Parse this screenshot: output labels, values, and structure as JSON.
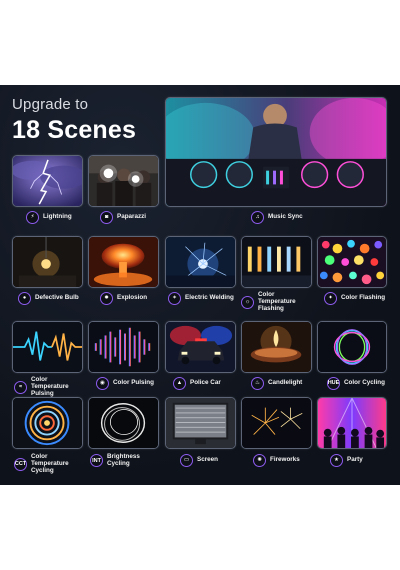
{
  "headline": {
    "upgrade": "Upgrade to",
    "title": "18 Scenes"
  },
  "scenes": [
    {
      "label": "Lightning",
      "icon": "lightning-icon"
    },
    {
      "label": "Paparazzi",
      "icon": "camera-icon"
    },
    {
      "label": "Music Sync",
      "icon": "music-note-icon"
    },
    {
      "label": "Defective Bulb",
      "icon": "bulb-icon"
    },
    {
      "label": "Explosion",
      "icon": "bomb-icon"
    },
    {
      "label": "Electric Welding",
      "icon": "spark-icon"
    },
    {
      "label": "Color Temperature Flashing",
      "icon": "color-temperature-icon"
    },
    {
      "label": "Color Flashing",
      "icon": "color-flash-icon"
    },
    {
      "label": "Color Temperature Pulsing",
      "icon": "wave-icon"
    },
    {
      "label": "Color Pulsing",
      "icon": "pulse-icon"
    },
    {
      "label": "Police Car",
      "icon": "police-light-icon"
    },
    {
      "label": "Candlelight",
      "icon": "flame-icon"
    },
    {
      "label": "Color Cycling",
      "icon_text": "HUE"
    },
    {
      "label": "Color Temperature Cycling",
      "icon_text": "CCT"
    },
    {
      "label": "Brightness Cycling",
      "icon_text": "INT"
    },
    {
      "label": "Screen",
      "icon": "screen-icon"
    },
    {
      "label": "Fireworks",
      "icon": "fireworks-icon"
    },
    {
      "label": "Party",
      "icon": "party-icon"
    }
  ],
  "colors": {
    "panel": "#10151f",
    "badge_ring": "#8e5cf0"
  }
}
